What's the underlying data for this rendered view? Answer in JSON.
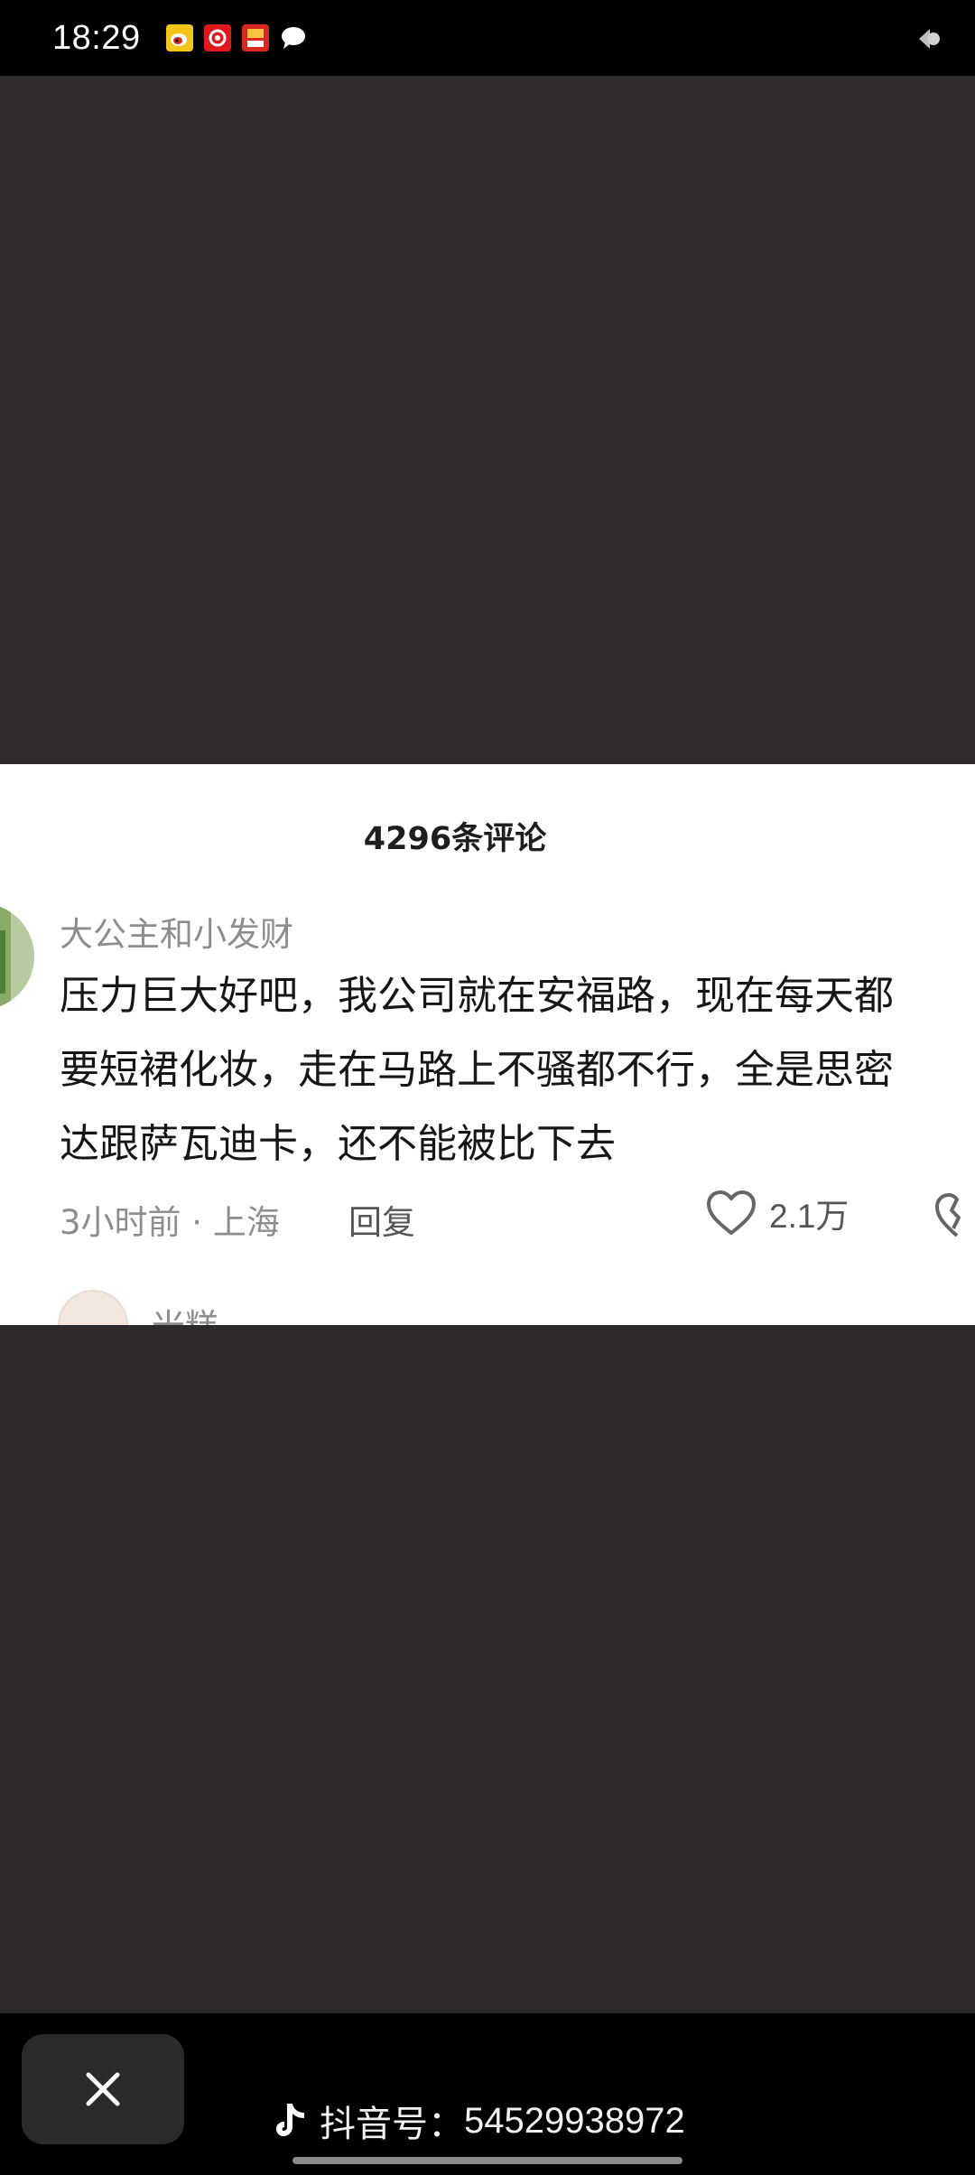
{
  "status_bar": {
    "time": "18:29",
    "icons": [
      "weibo-icon",
      "netease-news-icon",
      "app-badge-icon",
      "message-bubble-icon"
    ]
  },
  "comment_panel": {
    "header": "4296条评论",
    "comment": {
      "username": "大公主和小发财",
      "text": "压力巨大好吧，我公司就在安福路，现在每天都\n要短裙化妆，走在马路上不骚都不行，全是思密\n达跟萨瓦迪卡，还不能被比下去",
      "time_location": "3小时前 · 上海",
      "reply_label": "回复",
      "like_count": "2.1万"
    },
    "next_comment": {
      "username": "米糕"
    }
  },
  "bottom_bar": {
    "close_icon": "close-icon",
    "douyin_label": "抖音号：",
    "douyin_number": "54529938972"
  },
  "colors": {
    "background": "#2f2c2b",
    "panel": "#ffffff",
    "bar": "#000000",
    "muted_text": "#8d8d8d"
  }
}
